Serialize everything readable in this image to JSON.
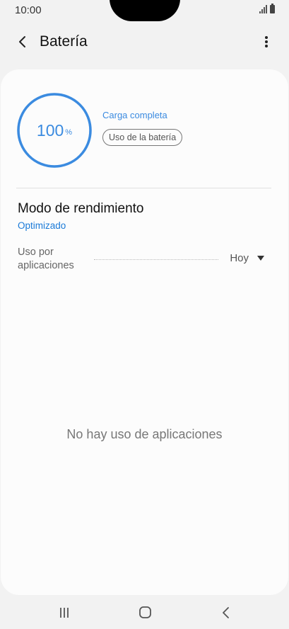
{
  "status_bar": {
    "time": "10:00"
  },
  "header": {
    "title": "Batería",
    "back_icon": "chevron-left-icon",
    "more_icon": "more-vertical-icon"
  },
  "battery": {
    "level": "100",
    "unit": "%",
    "level_fraction": 1.0,
    "charge_status": "Carga completa",
    "usage_button": "Uso de la batería"
  },
  "performance": {
    "title": "Modo de rendimiento",
    "value": "Optimizado"
  },
  "app_usage": {
    "label": "Uso por aplicaciones",
    "period": "Hoy",
    "empty_message": "No hay uso de aplicaciones"
  },
  "nav_bar": {
    "recents_icon": "recents-icon",
    "home_icon": "home-icon",
    "back_icon": "back-icon"
  },
  "colors": {
    "accent": "#3b8be0",
    "link": "#1a7ad8",
    "card_background": "#fcfcfc",
    "page_background": "#f2f2f2"
  }
}
